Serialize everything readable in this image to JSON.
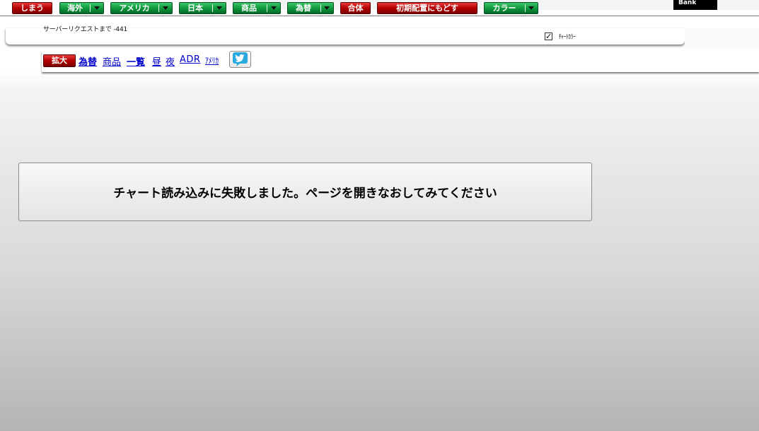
{
  "header": {
    "bank_label": "Bank",
    "server_status": "サーバーリクエストまで -441"
  },
  "toolbar": {
    "buttons": [
      {
        "label": "しまう",
        "color": "red",
        "dropdown": false
      },
      {
        "label": "海外",
        "color": "green",
        "dropdown": true
      },
      {
        "label": "アメリカ",
        "color": "green",
        "dropdown": true
      },
      {
        "label": "日本",
        "color": "green",
        "dropdown": true
      },
      {
        "label": "商品",
        "color": "green",
        "dropdown": true
      },
      {
        "label": "為替",
        "color": "green",
        "dropdown": true
      },
      {
        "label": "合体",
        "color": "red",
        "dropdown": false
      },
      {
        "label": "初期配置にもどす",
        "color": "red",
        "dropdown": false
      },
      {
        "label": "カラー",
        "color": "green",
        "dropdown": true
      }
    ],
    "chart_color_checkbox": {
      "checked": true,
      "label": "ﾁｬｰﾄｶﾗｰ"
    }
  },
  "subbar": {
    "zoom_label": "拡大",
    "links": [
      "為替",
      "商品",
      "一覧",
      "昼",
      "夜",
      "ADR",
      "ｱﾒﾘｶ"
    ],
    "twitter_icon": "twitter-bird-icon"
  },
  "message": {
    "text": "チャート読み込みに失敗しました。ページを開きなおしてみてください"
  },
  "colors": {
    "red_button": "#b30000",
    "green_button": "#0f9a3c",
    "link": "#0000cc",
    "twitter": "#2aa9e0"
  }
}
